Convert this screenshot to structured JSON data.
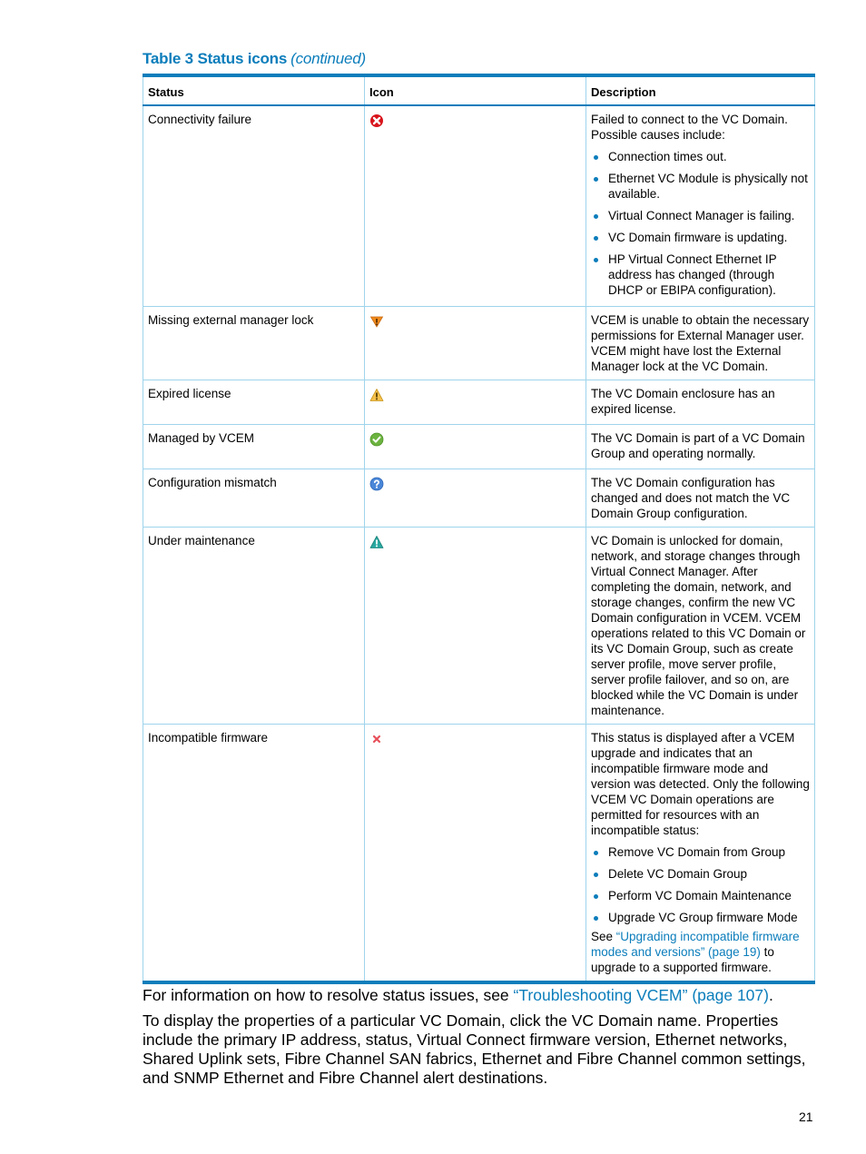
{
  "caption": {
    "label": "Table 3 Status icons",
    "continued": "(continued)"
  },
  "table": {
    "headers": [
      "Status",
      "Icon",
      "Description"
    ],
    "rows": [
      {
        "status": "Connectivity failure",
        "icon": "error-circle-icon",
        "description": "Failed to connect to the VC Domain. Possible causes include:",
        "bullets": [
          "Connection times out.",
          "Ethernet VC Module is physically not available.",
          "Virtual Connect Manager is failing.",
          "VC Domain firmware is updating.",
          "HP Virtual Connect Ethernet IP address has changed (through DHCP or EBIPA configuration)."
        ]
      },
      {
        "status": "Missing external manager lock",
        "icon": "lock-warning-icon",
        "description": "VCEM is unable to obtain the necessary permissions for External Manager user. VCEM might have lost the External Manager lock at the VC Domain."
      },
      {
        "status": "Expired license",
        "icon": "warning-triangle-icon",
        "description": "The VC Domain enclosure has an expired license."
      },
      {
        "status": "Managed by VCEM",
        "icon": "check-circle-icon",
        "description": "The VC Domain is part of a VC Domain Group and operating normally."
      },
      {
        "status": "Configuration mismatch",
        "icon": "question-circle-icon",
        "description": "The VC Domain configuration has changed and does not match the VC Domain Group configuration."
      },
      {
        "status": "Under maintenance",
        "icon": "maintenance-triangle-icon",
        "description": "VC Domain is unlocked for domain, network, and storage changes through Virtual Connect Manager. After completing the domain, network, and storage changes, confirm the new VC Domain configuration in VCEM. VCEM operations related to this VC Domain or its VC Domain Group, such as create server profile, move server profile, server profile failover, and so on, are blocked while the VC Domain is under maintenance."
      },
      {
        "status": "Incompatible firmware",
        "icon": "x-mark-icon",
        "description": "This status is displayed after a VCEM upgrade and indicates that an incompatible firmware mode and version was detected. Only the following VCEM VC Domain operations are permitted for resources with an incompatible status:",
        "bullets": [
          "Remove VC Domain from Group",
          "Delete VC Domain Group",
          "Perform VC Domain Maintenance",
          "Upgrade VC Group firmware Mode"
        ],
        "after_prefix": "See ",
        "after_link": "“Upgrading incompatible firmware modes and versions” (page 19)",
        "after_suffix": " to upgrade to a supported firmware."
      }
    ]
  },
  "body": {
    "p1_prefix": "For information on how to resolve status issues, see ",
    "p1_link": "“Troubleshooting VCEM” (page 107)",
    "p1_suffix": ".",
    "p2": "To display the properties of a particular VC Domain, click the VC Domain name. Properties include the primary IP address, status, Virtual Connect firmware version, Ethernet networks, Shared Uplink sets, Fibre Channel SAN fabrics, Ethernet and Fibre Channel common settings, and SNMP Ethernet and Fibre Channel alert destinations."
  },
  "page_number": "21",
  "colors": {
    "accent": "#0b7dbb",
    "rule_light": "#9fd4ec"
  }
}
